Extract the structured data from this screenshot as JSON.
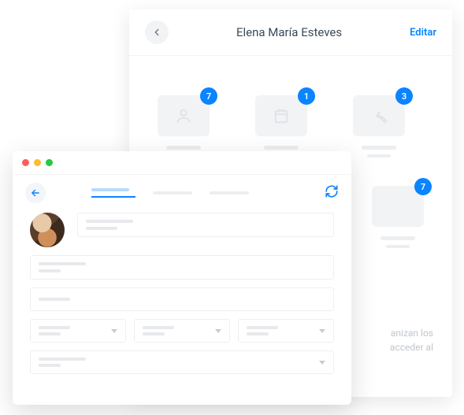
{
  "back": {
    "title": "Elena María Esteves",
    "edit_label": "Editar",
    "folders": [
      {
        "icon": "person",
        "count": 7
      },
      {
        "icon": "calendar",
        "count": 1
      },
      {
        "icon": "wrench",
        "count": 3
      }
    ],
    "folders_row2": [
      {
        "icon": "blank",
        "count": 7
      }
    ],
    "hint_line1": "anizan los",
    "hint_line2": "acceder al"
  },
  "front": {
    "tabs": [
      {
        "active": true
      },
      {
        "active": false
      },
      {
        "active": false
      }
    ]
  }
}
